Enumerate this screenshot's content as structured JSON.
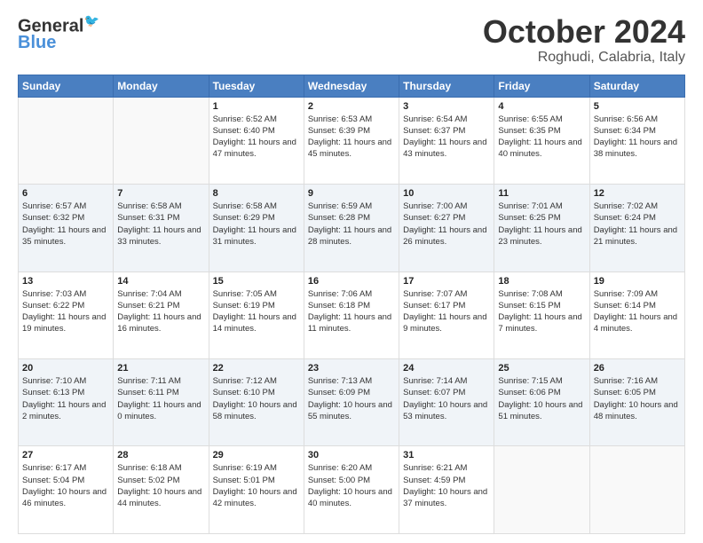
{
  "header": {
    "logo_line1": "General",
    "logo_line2": "Blue",
    "month": "October 2024",
    "location": "Roghudi, Calabria, Italy"
  },
  "weekdays": [
    "Sunday",
    "Monday",
    "Tuesday",
    "Wednesday",
    "Thursday",
    "Friday",
    "Saturday"
  ],
  "weeks": [
    [
      {
        "day": "",
        "info": ""
      },
      {
        "day": "",
        "info": ""
      },
      {
        "day": "1",
        "info": "Sunrise: 6:52 AM\nSunset: 6:40 PM\nDaylight: 11 hours and 47 minutes."
      },
      {
        "day": "2",
        "info": "Sunrise: 6:53 AM\nSunset: 6:39 PM\nDaylight: 11 hours and 45 minutes."
      },
      {
        "day": "3",
        "info": "Sunrise: 6:54 AM\nSunset: 6:37 PM\nDaylight: 11 hours and 43 minutes."
      },
      {
        "day": "4",
        "info": "Sunrise: 6:55 AM\nSunset: 6:35 PM\nDaylight: 11 hours and 40 minutes."
      },
      {
        "day": "5",
        "info": "Sunrise: 6:56 AM\nSunset: 6:34 PM\nDaylight: 11 hours and 38 minutes."
      }
    ],
    [
      {
        "day": "6",
        "info": "Sunrise: 6:57 AM\nSunset: 6:32 PM\nDaylight: 11 hours and 35 minutes."
      },
      {
        "day": "7",
        "info": "Sunrise: 6:58 AM\nSunset: 6:31 PM\nDaylight: 11 hours and 33 minutes."
      },
      {
        "day": "8",
        "info": "Sunrise: 6:58 AM\nSunset: 6:29 PM\nDaylight: 11 hours and 31 minutes."
      },
      {
        "day": "9",
        "info": "Sunrise: 6:59 AM\nSunset: 6:28 PM\nDaylight: 11 hours and 28 minutes."
      },
      {
        "day": "10",
        "info": "Sunrise: 7:00 AM\nSunset: 6:27 PM\nDaylight: 11 hours and 26 minutes."
      },
      {
        "day": "11",
        "info": "Sunrise: 7:01 AM\nSunset: 6:25 PM\nDaylight: 11 hours and 23 minutes."
      },
      {
        "day": "12",
        "info": "Sunrise: 7:02 AM\nSunset: 6:24 PM\nDaylight: 11 hours and 21 minutes."
      }
    ],
    [
      {
        "day": "13",
        "info": "Sunrise: 7:03 AM\nSunset: 6:22 PM\nDaylight: 11 hours and 19 minutes."
      },
      {
        "day": "14",
        "info": "Sunrise: 7:04 AM\nSunset: 6:21 PM\nDaylight: 11 hours and 16 minutes."
      },
      {
        "day": "15",
        "info": "Sunrise: 7:05 AM\nSunset: 6:19 PM\nDaylight: 11 hours and 14 minutes."
      },
      {
        "day": "16",
        "info": "Sunrise: 7:06 AM\nSunset: 6:18 PM\nDaylight: 11 hours and 11 minutes."
      },
      {
        "day": "17",
        "info": "Sunrise: 7:07 AM\nSunset: 6:17 PM\nDaylight: 11 hours and 9 minutes."
      },
      {
        "day": "18",
        "info": "Sunrise: 7:08 AM\nSunset: 6:15 PM\nDaylight: 11 hours and 7 minutes."
      },
      {
        "day": "19",
        "info": "Sunrise: 7:09 AM\nSunset: 6:14 PM\nDaylight: 11 hours and 4 minutes."
      }
    ],
    [
      {
        "day": "20",
        "info": "Sunrise: 7:10 AM\nSunset: 6:13 PM\nDaylight: 11 hours and 2 minutes."
      },
      {
        "day": "21",
        "info": "Sunrise: 7:11 AM\nSunset: 6:11 PM\nDaylight: 11 hours and 0 minutes."
      },
      {
        "day": "22",
        "info": "Sunrise: 7:12 AM\nSunset: 6:10 PM\nDaylight: 10 hours and 58 minutes."
      },
      {
        "day": "23",
        "info": "Sunrise: 7:13 AM\nSunset: 6:09 PM\nDaylight: 10 hours and 55 minutes."
      },
      {
        "day": "24",
        "info": "Sunrise: 7:14 AM\nSunset: 6:07 PM\nDaylight: 10 hours and 53 minutes."
      },
      {
        "day": "25",
        "info": "Sunrise: 7:15 AM\nSunset: 6:06 PM\nDaylight: 10 hours and 51 minutes."
      },
      {
        "day": "26",
        "info": "Sunrise: 7:16 AM\nSunset: 6:05 PM\nDaylight: 10 hours and 48 minutes."
      }
    ],
    [
      {
        "day": "27",
        "info": "Sunrise: 6:17 AM\nSunset: 5:04 PM\nDaylight: 10 hours and 46 minutes."
      },
      {
        "day": "28",
        "info": "Sunrise: 6:18 AM\nSunset: 5:02 PM\nDaylight: 10 hours and 44 minutes."
      },
      {
        "day": "29",
        "info": "Sunrise: 6:19 AM\nSunset: 5:01 PM\nDaylight: 10 hours and 42 minutes."
      },
      {
        "day": "30",
        "info": "Sunrise: 6:20 AM\nSunset: 5:00 PM\nDaylight: 10 hours and 40 minutes."
      },
      {
        "day": "31",
        "info": "Sunrise: 6:21 AM\nSunset: 4:59 PM\nDaylight: 10 hours and 37 minutes."
      },
      {
        "day": "",
        "info": ""
      },
      {
        "day": "",
        "info": ""
      }
    ]
  ]
}
